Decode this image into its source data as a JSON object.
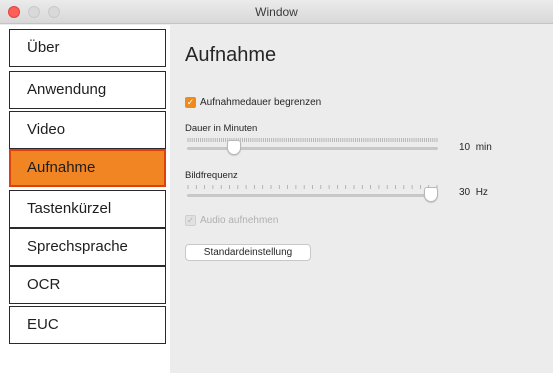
{
  "window": {
    "title": "Window"
  },
  "sidebar": {
    "items": [
      {
        "label": "Über"
      },
      {
        "label": "Anwendung"
      },
      {
        "label": "Video"
      },
      {
        "label": "Aufnahme"
      },
      {
        "label": "Tastenkürzel"
      },
      {
        "label": "Sprechsprache"
      },
      {
        "label": "OCR"
      },
      {
        "label": "EUC"
      }
    ],
    "selected_index": 3
  },
  "main": {
    "title": "Aufnahme",
    "limit_duration": {
      "label": "Aufnahmedauer begrenzen",
      "checked": true
    },
    "duration": {
      "label": "Dauer in Minuten",
      "value": "10",
      "unit": "min",
      "level": 0.17
    },
    "framerate": {
      "label": "Bildfrequenz",
      "value": "30",
      "unit": "Hz",
      "level": 1.0
    },
    "audio": {
      "label": "Audio aufnehmen",
      "checked": true,
      "enabled": false
    },
    "defaults_button": "Standardeinstellung"
  },
  "colors": {
    "accent": "#f18523",
    "selected_border": "#e0400c",
    "checkbox": "#ef8a1d"
  },
  "icons": {
    "checkmark": "checkmark-icon"
  }
}
